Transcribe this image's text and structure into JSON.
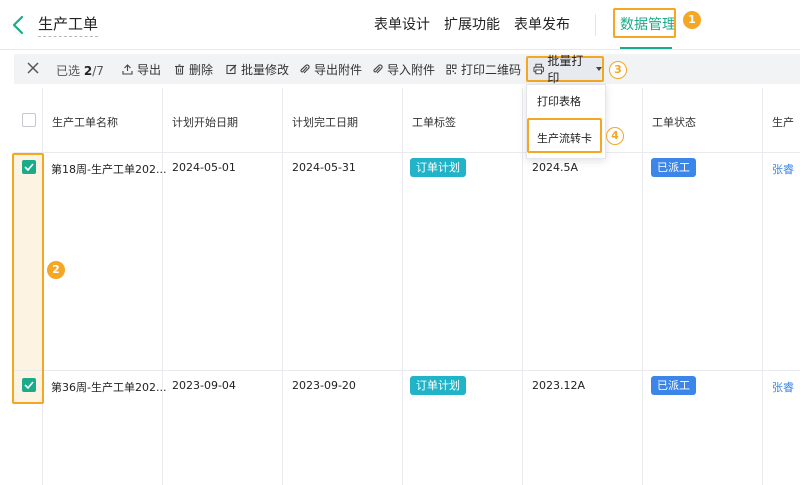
{
  "header": {
    "title": "生产工单",
    "tabs": [
      {
        "label": "表单设计",
        "active": false
      },
      {
        "label": "扩展功能",
        "active": false
      },
      {
        "label": "表单发布",
        "active": false
      },
      {
        "label": "数据管理",
        "active": true
      }
    ]
  },
  "markers": [
    "1",
    "2",
    "3",
    "4"
  ],
  "toolbar": {
    "selected_prefix": "已选",
    "selected_count": "2",
    "selected_total": "/7",
    "actions": {
      "export": "导出",
      "delete": "删除",
      "bulk_edit": "批量修改",
      "export_attachments": "导出附件",
      "import_attachments": "导入附件",
      "print_qrcode": "打印二维码",
      "bulk_print": "批量打印"
    }
  },
  "dropdown": {
    "items": [
      "打印表格",
      "生产流转卡"
    ],
    "highlighted": "生产流转卡"
  },
  "table": {
    "columns": [
      "生产工单名称",
      "计划开始日期",
      "计划完工日期",
      "工单标签",
      "工单状态",
      "生产"
    ],
    "rows": [
      {
        "checked": true,
        "name": "第18周-生产工单202...",
        "start": "2024-05-01",
        "end": "2024-05-31",
        "tag": "订单计划",
        "batch": "2024.5A",
        "status": "已派工",
        "assignee": "张睿"
      },
      {
        "checked": true,
        "name": "第36周-生产工单202...",
        "start": "2023-09-04",
        "end": "2023-09-20",
        "tag": "订单计划",
        "batch": "2023.12A",
        "status": "已派工",
        "assignee": "张睿"
      }
    ]
  },
  "colors": {
    "accent": "#1aab8a",
    "annotation": "#f5a623",
    "tag_cyan": "#21b3c8",
    "status_blue": "#3b86e8"
  }
}
